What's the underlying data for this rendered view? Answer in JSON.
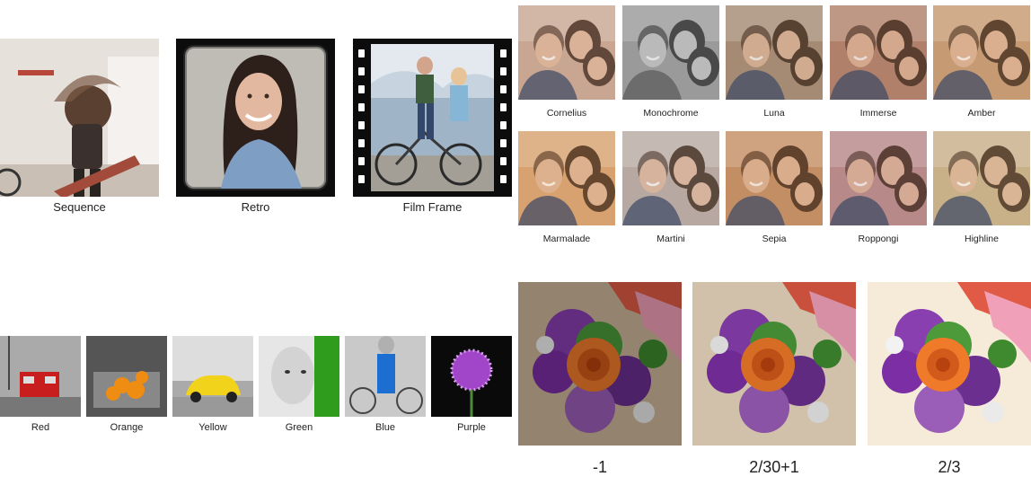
{
  "effects": {
    "sequence": "Sequence",
    "retro": "Retro",
    "film_frame": "Film Frame"
  },
  "filters": [
    {
      "label": "Cornelius",
      "tint": "#c9a792"
    },
    {
      "label": "Monochrome",
      "tint": "#9a9a9a"
    },
    {
      "label": "Luna",
      "tint": "#a68b74"
    },
    {
      "label": "Immerse",
      "tint": "#b0806a"
    },
    {
      "label": "Amber",
      "tint": "#c79a72"
    },
    {
      "label": "Marmalade",
      "tint": "#d7a36f"
    },
    {
      "label": "Martini",
      "tint": "#b7aaa3"
    },
    {
      "label": "Sepia",
      "tint": "#c48e64"
    },
    {
      "label": "Roppongi",
      "tint": "#b78a8a"
    },
    {
      "label": "Highline",
      "tint": "#c8b18a"
    }
  ],
  "color_accents": [
    {
      "label": "Red",
      "accent": "#c81e1e"
    },
    {
      "label": "Orange",
      "accent": "#ef8c12"
    },
    {
      "label": "Yellow",
      "accent": "#f2d31b"
    },
    {
      "label": "Green",
      "accent": "#2f9c1e"
    },
    {
      "label": "Blue",
      "accent": "#1c6fd0"
    },
    {
      "label": "Purple",
      "accent": "#a146c8"
    }
  ],
  "exposure": [
    {
      "label": "-1",
      "bg": "#cdb79a",
      "dim": 0.28
    },
    {
      "label": "2/30+1",
      "bg": "#e9d7bf",
      "dim": 0.1
    },
    {
      "label": "2/3",
      "bg": "#f6ead9",
      "dim": 0.0
    }
  ]
}
